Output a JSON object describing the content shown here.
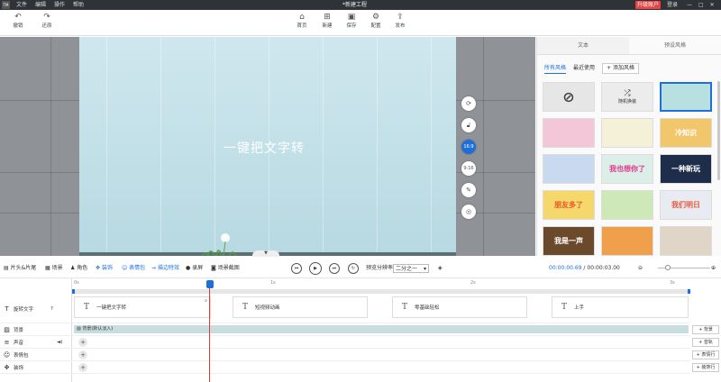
{
  "titlebar": {
    "logo": "TM",
    "menu": [
      "文件",
      "编辑",
      "操作",
      "帮助"
    ],
    "title": "*新建工程",
    "upgrade": "升级账户",
    "login": "登录",
    "win": [
      "—",
      "□",
      "✕"
    ]
  },
  "toolbar": {
    "undo": "撤销",
    "redo": "还原",
    "home": "首页",
    "new": "新建",
    "save": "保存",
    "settings": "配置",
    "publish": "发布"
  },
  "stage": {
    "text": "一键把文字转"
  },
  "side_buttons": {
    "ratio_169": "16:9",
    "ratio_916": "9:16"
  },
  "right_panel": {
    "tabs": [
      "文本",
      "预设风格"
    ],
    "subtabs": {
      "all": "所有风格",
      "recent": "最近使用",
      "add": "添加风格"
    },
    "random_label": "随机换装",
    "thumbs": [
      {
        "text": "",
        "bg": "#b9e0e0",
        "color": "#fff"
      },
      {
        "text": "",
        "bg": "#f4c7d8",
        "color": "#555"
      },
      {
        "text": "",
        "bg": "#f5f0d8",
        "color": "#e8a33a"
      },
      {
        "text": "冷知识",
        "bg": "#f2c66b",
        "color": "#fff"
      },
      {
        "text": "",
        "bg": "#c9d9f0",
        "color": "#334"
      },
      {
        "text": "我也想你了",
        "bg": "#dbeee8",
        "color": "#e23b8c"
      },
      {
        "text": "一种新玩",
        "bg": "#1d2d4a",
        "color": "#fff"
      },
      {
        "text": "朋友多了",
        "bg": "#f6d76b",
        "color": "#e8572a"
      },
      {
        "text": "",
        "bg": "#cfe8b8",
        "color": "#555"
      },
      {
        "text": "我们明日",
        "bg": "#e8ecf2",
        "color": "#e85a40"
      },
      {
        "text": "我是一声",
        "bg": "#6b4a2c",
        "color": "#fff"
      },
      {
        "text": "",
        "bg": "#f0a04a",
        "color": "#fff"
      },
      {
        "text": "",
        "bg": "#e0d6c8",
        "color": "#333"
      }
    ]
  },
  "controls": {
    "items": [
      "片头&片尾",
      "场景",
      "角色",
      "装饰",
      "表情包",
      "描边特效",
      "录屏",
      "场景截图"
    ],
    "ratio_label": "预览分辨率",
    "ratio_value": "二分之一",
    "time_current": "00:00:00.69",
    "time_sep": "/",
    "time_total": "00:00:03.00"
  },
  "ruler": [
    "0s",
    "1s",
    "2s",
    "3s"
  ],
  "tracks": {
    "labels": [
      "旋转文字",
      "背景",
      "声音",
      "表情包",
      "装饰"
    ],
    "text_clips": [
      "一键把文字转",
      "短视频动画",
      "零基础轻松",
      "上手"
    ],
    "bg_clip": "背景(默认淡入)",
    "right_buttons": [
      "背景",
      "音轨",
      "表情行",
      "装饰行"
    ]
  },
  "colors": {
    "accent": "#1e6fd9",
    "upgrade": "#e64545",
    "playhead": "#e33333"
  }
}
